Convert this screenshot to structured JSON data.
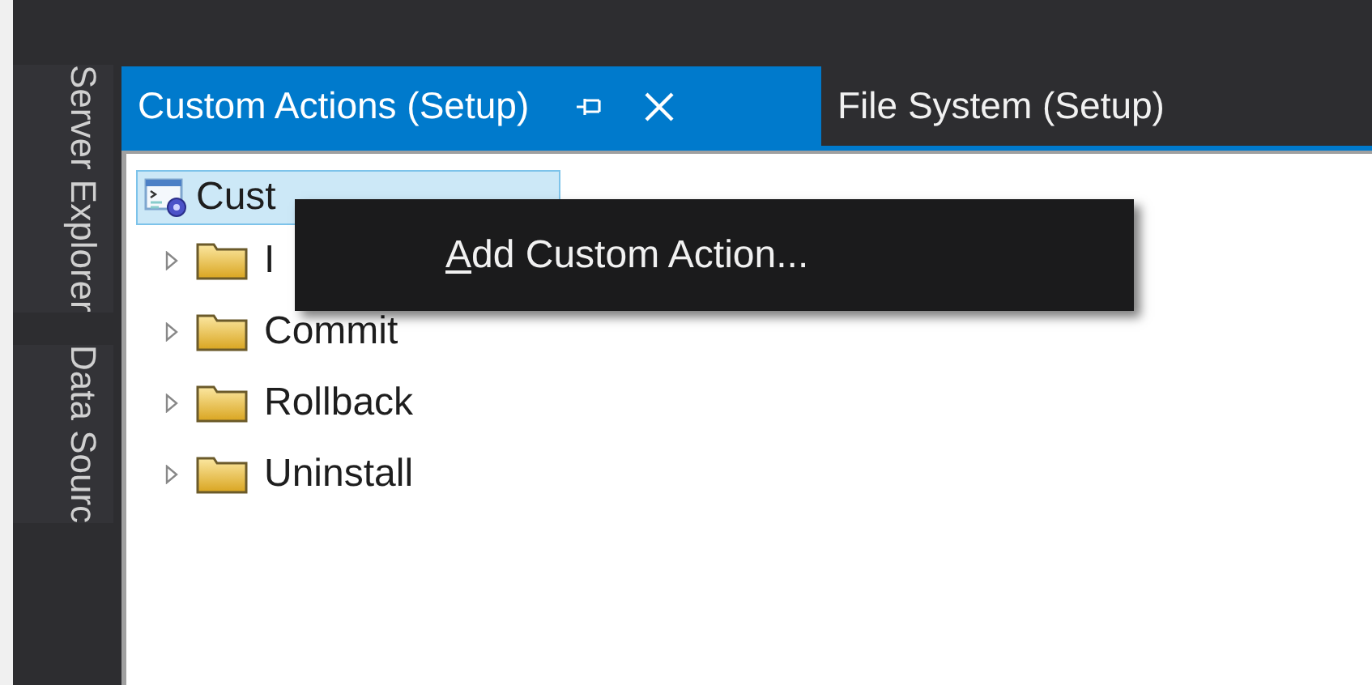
{
  "side_tabs": [
    {
      "label": "Server Explorer"
    },
    {
      "label": "Data Sourc"
    }
  ],
  "tabs": [
    {
      "label": "Custom Actions (Setup)",
      "selected": true
    },
    {
      "label": "File System (Setup)",
      "selected": false
    }
  ],
  "tree": {
    "root": {
      "label": "Cust",
      "selected": true
    },
    "children": [
      {
        "label": "I",
        "expanded": false
      },
      {
        "label": "Commit",
        "expanded": false
      },
      {
        "label": "Rollback",
        "expanded": false
      },
      {
        "label": "Uninstall",
        "expanded": false
      }
    ]
  },
  "context_menu": {
    "items": [
      {
        "accelerator": "A",
        "rest": "dd Custom Action..."
      }
    ]
  }
}
